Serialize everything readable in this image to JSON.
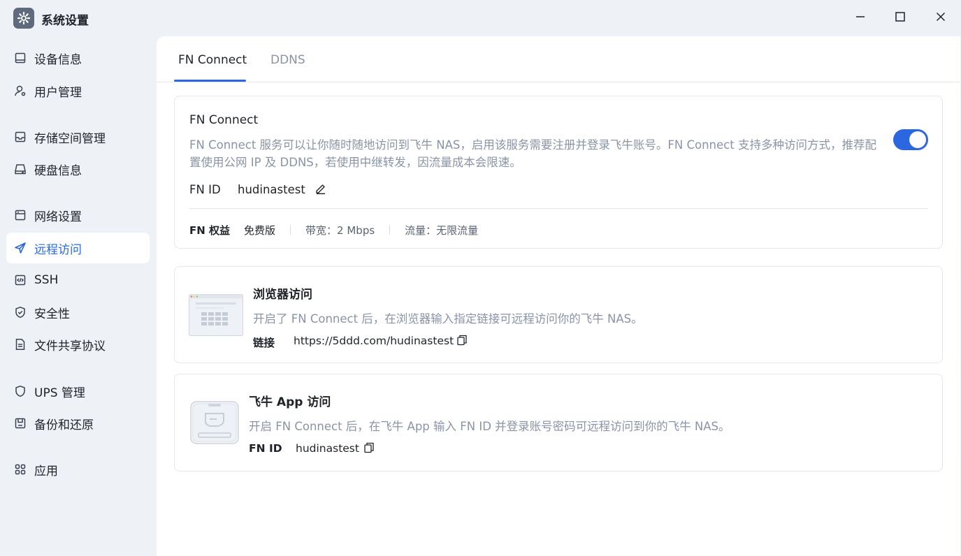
{
  "window": {
    "title": "系统设置",
    "app_icon": "gear-icon"
  },
  "sidebar": {
    "items": [
      {
        "label": "设备信息",
        "icon": "device-icon"
      },
      {
        "label": "用户管理",
        "icon": "user-gear-icon"
      },
      {
        "label": "存储空间管理",
        "icon": "storage-icon"
      },
      {
        "label": "硬盘信息",
        "icon": "disk-icon"
      },
      {
        "label": "网络设置",
        "icon": "network-icon"
      },
      {
        "label": "远程访问",
        "icon": "send-icon",
        "active": true
      },
      {
        "label": "SSH",
        "icon": "code-icon"
      },
      {
        "label": "安全性",
        "icon": "shield-check-icon"
      },
      {
        "label": "文件共享协议",
        "icon": "file-icon"
      },
      {
        "label": "UPS 管理",
        "icon": "shield-icon"
      },
      {
        "label": "备份和还原",
        "icon": "backup-icon"
      },
      {
        "label": "应用",
        "icon": "apps-icon"
      }
    ]
  },
  "tabs": [
    {
      "label": "FN Connect",
      "active": true
    },
    {
      "label": "DDNS",
      "active": false
    }
  ],
  "fn_connect": {
    "title": "FN Connect",
    "description": "FN Connect 服务可以让你随时随地访问到飞牛 NAS，启用该服务需要注册并登录飞牛账号。FN Connect 支持多种访问方式，推荐配置使用公网 IP 及 DDNS，若使用中继转发，因流量成本会限速。",
    "enabled": true,
    "fnid_label": "FN ID",
    "fnid_value": "hudinastest",
    "rights_label": "FN 权益",
    "rights_plan": "免费版",
    "bandwidth": "带宽：2 Mbps",
    "traffic": "流量：无限流量"
  },
  "browser_access": {
    "title": "浏览器访问",
    "description": "开启了 FN Connect 后，在浏览器输入指定链接可远程访问你的飞牛 NAS。",
    "link_label": "链接",
    "link_value": "https://5ddd.com/hudinastest"
  },
  "app_access": {
    "title": "飞牛 App 访问",
    "description": "开启 FN Connect 后，在飞牛 App 输入 FN ID 并登录账号密码可远程访问到你的飞牛 NAS。",
    "fnid_label": "FN ID",
    "fnid_value": "hudinastest"
  },
  "colors": {
    "accent": "#2b67e0",
    "muted": "#8a94a6",
    "background": "#eef1f6"
  }
}
